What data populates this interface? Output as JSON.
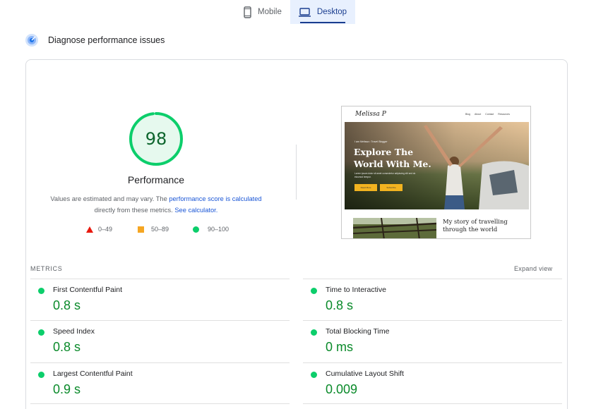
{
  "tabs": [
    {
      "label": "Mobile",
      "icon": "phone-icon",
      "active": false
    },
    {
      "label": "Desktop",
      "icon": "laptop-icon",
      "active": true
    }
  ],
  "section": {
    "title": "Diagnose performance issues",
    "icon": "diagnose-icon"
  },
  "score": {
    "value": "98",
    "fraction": 0.98,
    "label": "Performance",
    "color": "#0cce6b"
  },
  "note": {
    "prefix": "Values are estimated and may vary. The ",
    "link1": "performance score is calculated",
    "middle": " directly from these metrics. ",
    "link2": "See calculator."
  },
  "legend": [
    {
      "range": "0–49",
      "shape": "triangle",
      "color": "#e8190e"
    },
    {
      "range": "50–89",
      "shape": "square",
      "color": "#f5a623"
    },
    {
      "range": "90–100",
      "shape": "circle",
      "color": "#0cce6b"
    }
  ],
  "preview": {
    "logo": "Melissa P",
    "menu": [
      "Blog",
      "About",
      "Contact",
      "Resources"
    ],
    "kicker": "I am Melissa • Travel Blogger",
    "title_line1": "Explore The",
    "title_line2": "World With Me.",
    "text": "Lorem ipsum dolor sit amet consectetur adipiscing elit sed do eiusmod tempor.",
    "button1": "Read More",
    "button2": "Subscribe",
    "story_line1": "My story of travelling",
    "story_line2": "through the world"
  },
  "metrics": {
    "heading": "METRICS",
    "expand": "Expand view",
    "items": [
      {
        "label": "First Contentful Paint",
        "value": "0.8 s"
      },
      {
        "label": "Time to Interactive",
        "value": "0.8 s"
      },
      {
        "label": "Speed Index",
        "value": "0.8 s"
      },
      {
        "label": "Total Blocking Time",
        "value": "0 ms"
      },
      {
        "label": "Largest Contentful Paint",
        "value": "0.9 s"
      },
      {
        "label": "Cumulative Layout Shift",
        "value": "0.009"
      }
    ]
  },
  "colors": {
    "accent": "#1a3d8f",
    "good": "#0cce6b",
    "good_text": "#0a8a2a",
    "link": "#1a56d6"
  }
}
